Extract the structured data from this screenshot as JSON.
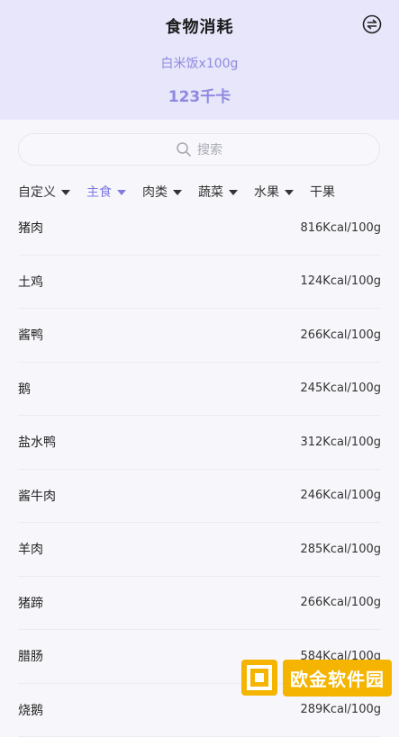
{
  "header": {
    "title": "食物消耗",
    "food_line": "白米饭x100g",
    "kcal_line": "123千卡",
    "swap_icon": "swap-icon"
  },
  "search": {
    "placeholder": "搜索"
  },
  "tabs": [
    {
      "label": "自定义",
      "active": false
    },
    {
      "label": "主食",
      "active": true
    },
    {
      "label": "肉类",
      "active": false
    },
    {
      "label": "蔬菜",
      "active": false
    },
    {
      "label": "水果",
      "active": false
    },
    {
      "label": "干果",
      "active": false
    }
  ],
  "items": [
    {
      "name": "猪肉",
      "value": "816Kcal/100g"
    },
    {
      "name": "土鸡",
      "value": "124Kcal/100g"
    },
    {
      "name": "酱鸭",
      "value": "266Kcal/100g"
    },
    {
      "name": "鹅",
      "value": "245Kcal/100g"
    },
    {
      "name": "盐水鸭",
      "value": "312Kcal/100g"
    },
    {
      "name": "酱牛肉",
      "value": "246Kcal/100g"
    },
    {
      "name": "羊肉",
      "value": "285Kcal/100g"
    },
    {
      "name": "猪蹄",
      "value": "266Kcal/100g"
    },
    {
      "name": "腊肠",
      "value": "584Kcal/100g"
    },
    {
      "name": "烧鹅",
      "value": "289Kcal/100g"
    }
  ],
  "colors": {
    "accent": "#7f7ae1",
    "header_bg": "#e7e6fb",
    "watermark": "#f4b400"
  },
  "watermark": {
    "text": "欧金软件园"
  }
}
